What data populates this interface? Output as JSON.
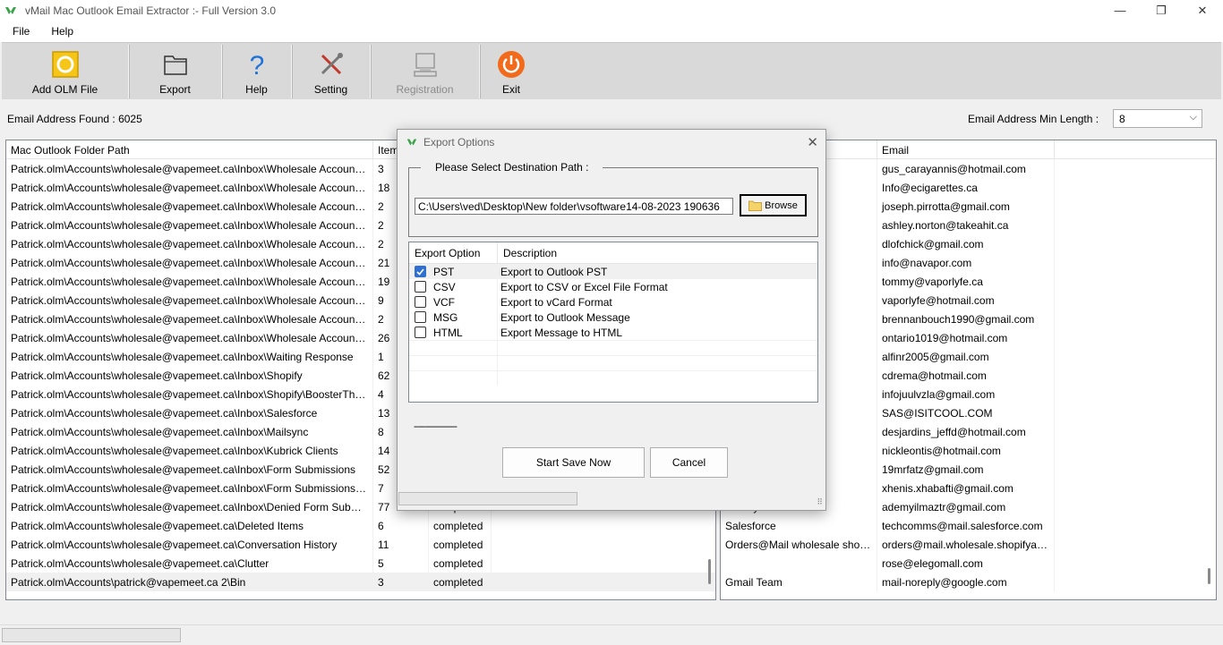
{
  "window": {
    "title": "vMail Mac Outlook Email Extractor :- Full Version 3.0",
    "minimize": "—",
    "maximize": "❐",
    "close": "✕"
  },
  "menu": [
    "File",
    "Help"
  ],
  "toolbar": [
    {
      "label": "Add OLM File",
      "icon": "olm-file-icon"
    },
    {
      "label": "Export",
      "icon": "export-folder-icon"
    },
    {
      "label": "Help",
      "icon": "question-mark-icon"
    },
    {
      "label": "Setting",
      "icon": "tools-icon"
    },
    {
      "label": "Registration",
      "icon": "registration-icon",
      "disabled": true
    },
    {
      "label": "Exit",
      "icon": "power-icon"
    }
  ],
  "info": {
    "found_label": "Email Address Found :",
    "found_value": "6025",
    "min_length_label": "Email Address Min Length :",
    "min_length_value": "8"
  },
  "left_grid": {
    "headers": [
      "Mac Outlook Folder Path",
      "Items"
    ],
    "rows": [
      {
        "path": "Patrick.olm\\Accounts\\wholesale@vapemeet.ca\\Inbox\\Wholesale Accounts\\Aries...",
        "items": "3",
        "status": ""
      },
      {
        "path": "Patrick.olm\\Accounts\\wholesale@vapemeet.ca\\Inbox\\Wholesale Accounts\\Anyti...",
        "items": "18",
        "status": ""
      },
      {
        "path": "Patrick.olm\\Accounts\\wholesale@vapemeet.ca\\Inbox\\Wholesale Accounts\\Anyti...",
        "items": "2",
        "status": ""
      },
      {
        "path": "Patrick.olm\\Accounts\\wholesale@vapemeet.ca\\Inbox\\Wholesale Accounts\\Ama...",
        "items": "2",
        "status": ""
      },
      {
        "path": "Patrick.olm\\Accounts\\wholesale@vapemeet.ca\\Inbox\\Wholesale Accounts\\Alwa...",
        "items": "2",
        "status": ""
      },
      {
        "path": "Patrick.olm\\Accounts\\wholesale@vapemeet.ca\\Inbox\\Wholesale Accounts\\Acm...",
        "items": "21",
        "status": ""
      },
      {
        "path": "Patrick.olm\\Accounts\\wholesale@vapemeet.ca\\Inbox\\Wholesale Accounts\\Ace ...",
        "items": "19",
        "status": ""
      },
      {
        "path": "Patrick.olm\\Accounts\\wholesale@vapemeet.ca\\Inbox\\Wholesale Accounts\\902 ...",
        "items": "9",
        "status": ""
      },
      {
        "path": "Patrick.olm\\Accounts\\wholesale@vapemeet.ca\\Inbox\\Wholesale Accounts\\437 ...",
        "items": "2",
        "status": ""
      },
      {
        "path": "Patrick.olm\\Accounts\\wholesale@vapemeet.ca\\Inbox\\Wholesale Accounts\\11:1...",
        "items": "26",
        "status": ""
      },
      {
        "path": "Patrick.olm\\Accounts\\wholesale@vapemeet.ca\\Inbox\\Waiting Response",
        "items": "1",
        "status": ""
      },
      {
        "path": "Patrick.olm\\Accounts\\wholesale@vapemeet.ca\\Inbox\\Shopify",
        "items": "62",
        "status": ""
      },
      {
        "path": "Patrick.olm\\Accounts\\wholesale@vapemeet.ca\\Inbox\\Shopify\\BoosterTheme",
        "items": "4",
        "status": ""
      },
      {
        "path": "Patrick.olm\\Accounts\\wholesale@vapemeet.ca\\Inbox\\Salesforce",
        "items": "13",
        "status": ""
      },
      {
        "path": "Patrick.olm\\Accounts\\wholesale@vapemeet.ca\\Inbox\\Mailsync",
        "items": "8",
        "status": ""
      },
      {
        "path": "Patrick.olm\\Accounts\\wholesale@vapemeet.ca\\Inbox\\Kubrick Clients",
        "items": "14",
        "status": ""
      },
      {
        "path": "Patrick.olm\\Accounts\\wholesale@vapemeet.ca\\Inbox\\Form Submissions",
        "items": "52",
        "status": ""
      },
      {
        "path": "Patrick.olm\\Accounts\\wholesale@vapemeet.ca\\Inbox\\Form Submissions\\Ken Ross",
        "items": "7",
        "status": ""
      },
      {
        "path": "Patrick.olm\\Accounts\\wholesale@vapemeet.ca\\Inbox\\Denied Form Submissions",
        "items": "77",
        "status": "completed"
      },
      {
        "path": "Patrick.olm\\Accounts\\wholesale@vapemeet.ca\\Deleted Items",
        "items": "6",
        "status": "completed"
      },
      {
        "path": "Patrick.olm\\Accounts\\wholesale@vapemeet.ca\\Conversation History",
        "items": "11",
        "status": "completed"
      },
      {
        "path": "Patrick.olm\\Accounts\\wholesale@vapemeet.ca\\Clutter",
        "items": "5",
        "status": "completed"
      },
      {
        "path": "Patrick.olm\\Accounts\\patrick@vapemeet.ca 2\\Bin",
        "items": "3",
        "status": "completed"
      }
    ]
  },
  "right_grid": {
    "headers": [
      "",
      "Email"
    ],
    "rows": [
      {
        "name": "",
        "email": "gus_carayannis@hotmail.com"
      },
      {
        "name": "",
        "email": "Info@ecigarettes.ca"
      },
      {
        "name": "",
        "email": "joseph.pirrotta@gmail.com"
      },
      {
        "name": "",
        "email": "ashley.norton@takeahit.ca"
      },
      {
        "name": "",
        "email": "dlofchick@gmail.com"
      },
      {
        "name": "",
        "email": "info@navapor.com"
      },
      {
        "name": "",
        "email": "tommy@vaporlyfe.ca"
      },
      {
        "name": "",
        "email": "vaporlyfe@hotmail.com"
      },
      {
        "name": "",
        "email": "brennanbouch1990@gmail.com"
      },
      {
        "name": "",
        "email": "ontario1019@hotmail.com"
      },
      {
        "name": "",
        "email": "alfinr2005@gmail.com"
      },
      {
        "name": "",
        "email": "cdrema@hotmail.com"
      },
      {
        "name": "",
        "email": "infojuulvzla@gmail.com"
      },
      {
        "name": "",
        "email": "SAS@ISITCOOL.COM"
      },
      {
        "name": "",
        "email": "desjardins_jeffd@hotmail.com"
      },
      {
        "name": "",
        "email": "nickleontis@hotmail.com"
      },
      {
        "name": "",
        "email": "19mrfatz@gmail.com"
      },
      {
        "name": "",
        "email": "xhenis.xhabafti@gmail.com"
      },
      {
        "name": "Ademyilmaztr",
        "email": "ademyilmaztr@gmail.com"
      },
      {
        "name": "Salesforce",
        "email": "techcomms@mail.salesforce.com"
      },
      {
        "name": "Orders@Mail wholesale shopifyap...",
        "email": "orders@mail.wholesale.shopifyapps.com"
      },
      {
        "name": "",
        "email": "rose@elegomall.com"
      },
      {
        "name": "Gmail Team",
        "email": "mail-noreply@google.com"
      }
    ]
  },
  "dialog": {
    "title": "Export Options",
    "close": "✕",
    "group_label": "Please Select Destination Path :",
    "path": "C:\\Users\\ved\\Desktop\\New folder\\vsoftware14-08-2023 190636",
    "browse_label": "Browse",
    "headers": [
      "Export Option",
      "Description"
    ],
    "options": [
      {
        "name": "PST",
        "desc": "Export to Outlook PST",
        "checked": true
      },
      {
        "name": "CSV",
        "desc": "Export to CSV or Excel File Format",
        "checked": false
      },
      {
        "name": "VCF",
        "desc": "Export to vCard Format",
        "checked": false
      },
      {
        "name": "MSG",
        "desc": "Export to Outlook Message",
        "checked": false
      },
      {
        "name": "HTML",
        "desc": "Export Message to HTML",
        "checked": false
      }
    ],
    "dashes": "------------------",
    "start_label": "Start Save Now",
    "cancel_label": "Cancel"
  },
  "colors": {
    "accent": "#2f6fcf",
    "olm_yellow": "#f5c518",
    "exit_orange": "#f26b1d",
    "help_blue": "#1e73d9",
    "logo_green": "#3aa34a"
  }
}
